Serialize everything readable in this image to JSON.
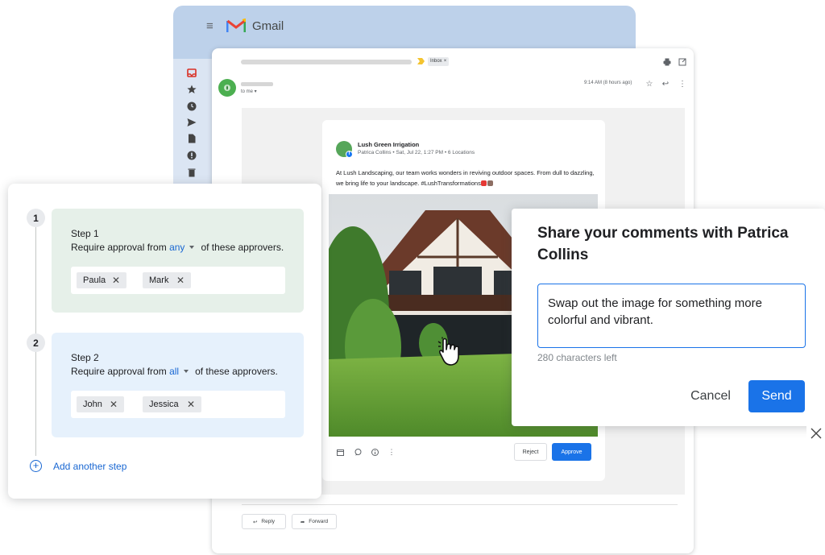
{
  "gmail": {
    "app_name": "Gmail",
    "rail_icons": [
      "inbox-icon",
      "star-icon",
      "clock-icon",
      "send-icon",
      "draft-icon",
      "alert-icon",
      "trash-icon"
    ]
  },
  "email": {
    "inbox_label": "Inbox",
    "to_me": "to me",
    "timestamp": "9:14 AM (8 hours ago)",
    "reply_label": "Reply",
    "forward_label": "Forward"
  },
  "post": {
    "page_name": "Lush Green Irrigation",
    "author": "Patrica Collins",
    "date": "Sat, Jul 22, 1:27 PM",
    "locations": "6 Locations",
    "text": "At Lush Landscaping, our team works wonders in reviving outdoor spaces. From dull to dazzling, we bring life to your landscape.  #LushTransformations",
    "reject_label": "Reject",
    "approve_label": "Approve"
  },
  "steps": [
    {
      "number": "1",
      "title": "Step 1",
      "desc_prefix": "Require approval from",
      "quantifier": "any",
      "desc_suffix": "of these approvers.",
      "approvers": [
        "Paula",
        "Mark"
      ]
    },
    {
      "number": "2",
      "title": "Step 2",
      "desc_prefix": "Require approval from",
      "quantifier": "all",
      "desc_suffix": "of these approvers.",
      "approvers": [
        "John",
        "Jessica"
      ]
    }
  ],
  "add_step_label": "Add another step",
  "comment_dialog": {
    "title": "Share your comments with Patrica Collins",
    "comment_value": "Swap out the image for something more colorful and vibrant.",
    "chars_left": "280 characters left",
    "cancel_label": "Cancel",
    "send_label": "Send"
  },
  "colors": {
    "accent_blue": "#1a73e8",
    "step1_bg": "#e6f0e9",
    "step2_bg": "#e6f1fc",
    "gmail_header": "#bdd1ea"
  }
}
